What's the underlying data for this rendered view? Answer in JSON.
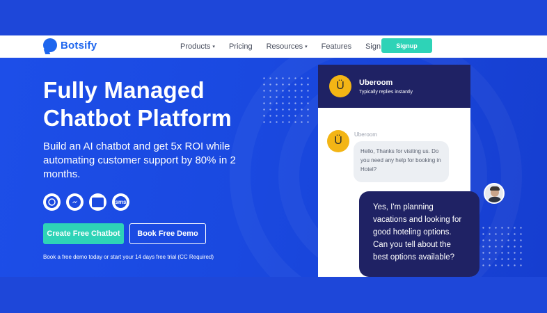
{
  "brand": {
    "name": "Botsify"
  },
  "nav": {
    "links": [
      {
        "label": "Products",
        "has_dropdown": true
      },
      {
        "label": "Pricing",
        "has_dropdown": false
      },
      {
        "label": "Resources",
        "has_dropdown": true
      },
      {
        "label": "Features",
        "has_dropdown": false
      },
      {
        "label": "Sign in",
        "has_dropdown": false
      }
    ],
    "signup_label": "Signup",
    "dropdown_glyph": "▾"
  },
  "hero": {
    "headline_line1": "Fully Managed",
    "headline_line2": "Chatbot Platform",
    "subtext": "Build an AI chatbot and get 5x ROI while automating customer support by 80% in 2 months.",
    "channels": [
      "whatsapp-icon",
      "messenger-icon",
      "web-chat-icon",
      "sms-icon"
    ],
    "sms_glyph": "sms",
    "primary_cta": "Create Free Chatbot",
    "secondary_cta": "Book Free Demo",
    "note": "Book a free demo today or start your 14 days free trial (CC Required)"
  },
  "chat": {
    "header_name": "Uberoom",
    "header_status": "Typically replies instantly",
    "avatar_glyph": "Ü",
    "bot_name": "Uberoom",
    "bot_message": "Hello, Thanks for visiting us. Do you need any help for booking in Hotel?",
    "user_message": "Yes, I'm planning vacations and looking for good hoteling options. Can you tell about the best options available?"
  },
  "colors": {
    "primary_blue": "#1a49e0",
    "accent_teal": "#2ed3b7",
    "chat_navy": "#1f2264",
    "avatar_yellow": "#f3b515"
  }
}
